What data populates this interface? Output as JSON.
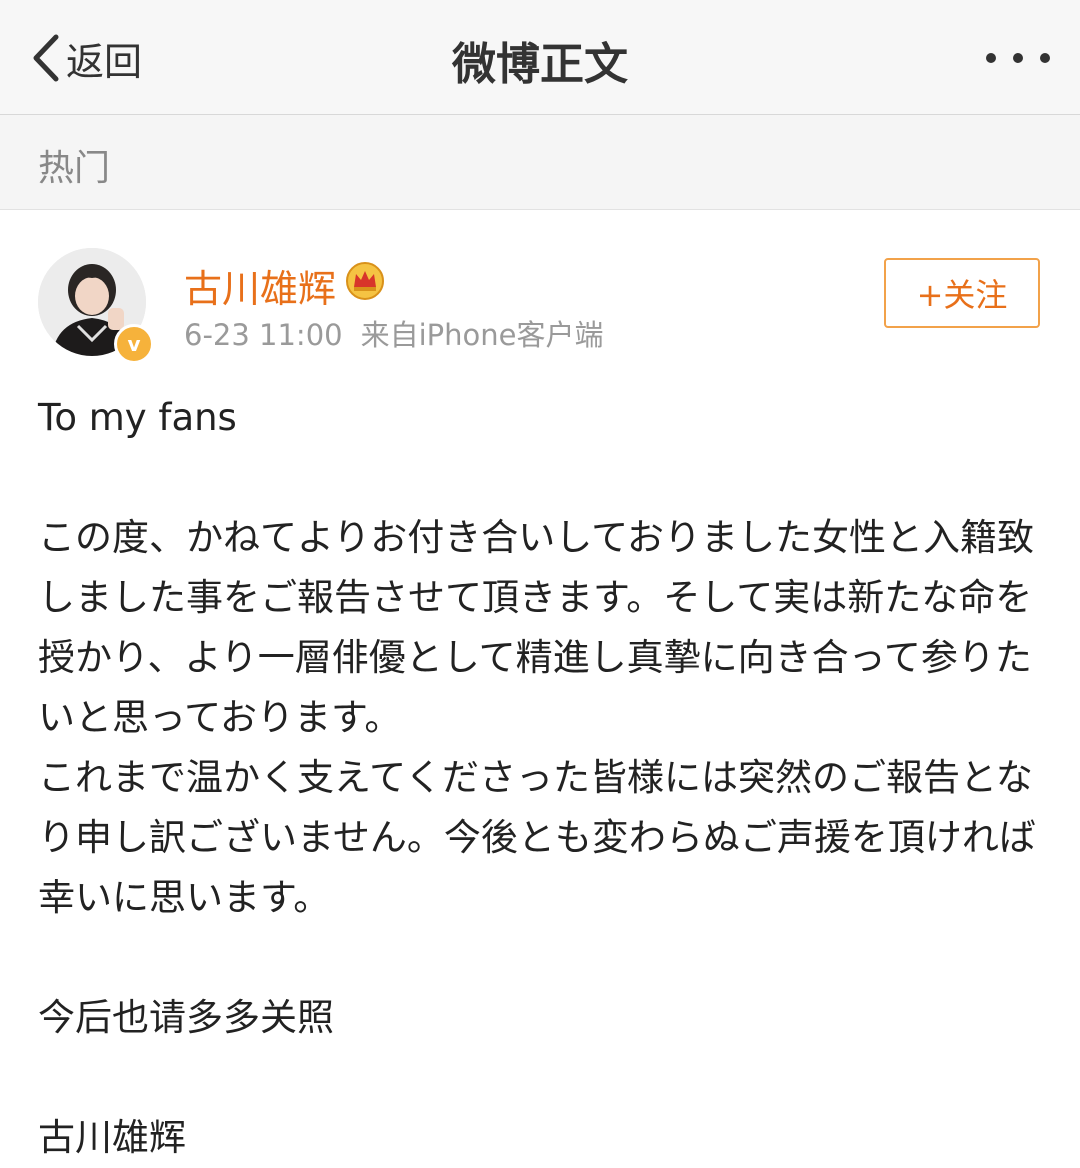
{
  "navbar": {
    "back_label": "返回",
    "title": "微博正文",
    "more_icon": "more-dots-icon"
  },
  "section": {
    "label": "热门"
  },
  "post": {
    "author": "古川雄辉",
    "badge_icon": "crown-icon",
    "verified_icon": "verified-badge-icon",
    "verified_mark": "v",
    "time": "6-23 11:00",
    "source": "来自iPhone客户端",
    "follow_label": "+关注",
    "greeting": "To my fans",
    "paragraph1": "この度、かねてよりお付き合いしておりました女性と入籍致しました事をご報告させて頂きます。そして実は新たな命を授かり、より一層俳優として精進し真摯に向き合って参りたいと思っております。",
    "paragraph2": "これまで温かく支えてくださった皆様には突然のご報告となり申し訳ございません。今後とも変わらぬご声援を頂ければ幸いに思います。",
    "closing": "今后也请多多关照",
    "signature": "古川雄辉"
  },
  "colors": {
    "accent_orange": "#e8701a",
    "follow_border": "#f2a24a",
    "navbar_bg": "#f7f7f7",
    "meta_gray": "#9a9a9a",
    "verified_gold": "#f6b23b"
  }
}
